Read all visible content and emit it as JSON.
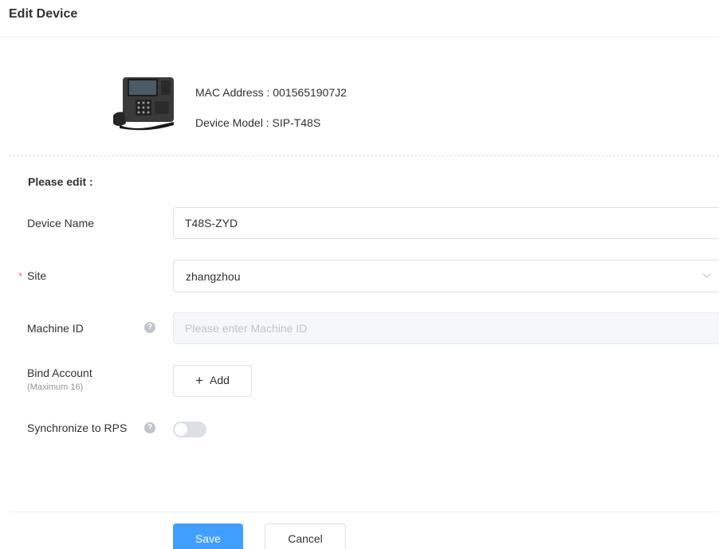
{
  "dialog": {
    "title": "Edit Device"
  },
  "device": {
    "mac_label": "MAC Address :",
    "mac_value": "0015651907J2",
    "model_label": "Device Model :",
    "model_value": "SIP-T48S"
  },
  "form": {
    "section_title": "Please edit :",
    "device_name": {
      "label": "Device Name",
      "value": "T48S-ZYD"
    },
    "site": {
      "required_mark": "*",
      "label": "Site",
      "value": "zhangzhou"
    },
    "machine_id": {
      "label": "Machine ID",
      "help": "?",
      "placeholder": "Please enter Machine ID",
      "value": ""
    },
    "bind_account": {
      "label": "Bind Account",
      "sub_label": "(Maximum 16)",
      "add_icon": "+",
      "add_label": "Add"
    },
    "sync_rps": {
      "label": "Synchronize to RPS",
      "help": "?",
      "enabled": false
    }
  },
  "footer": {
    "save_label": "Save",
    "cancel_label": "Cancel"
  },
  "colors": {
    "primary": "#409eff",
    "required": "#f56c6c",
    "toggle_off": "#dcdfe6"
  }
}
